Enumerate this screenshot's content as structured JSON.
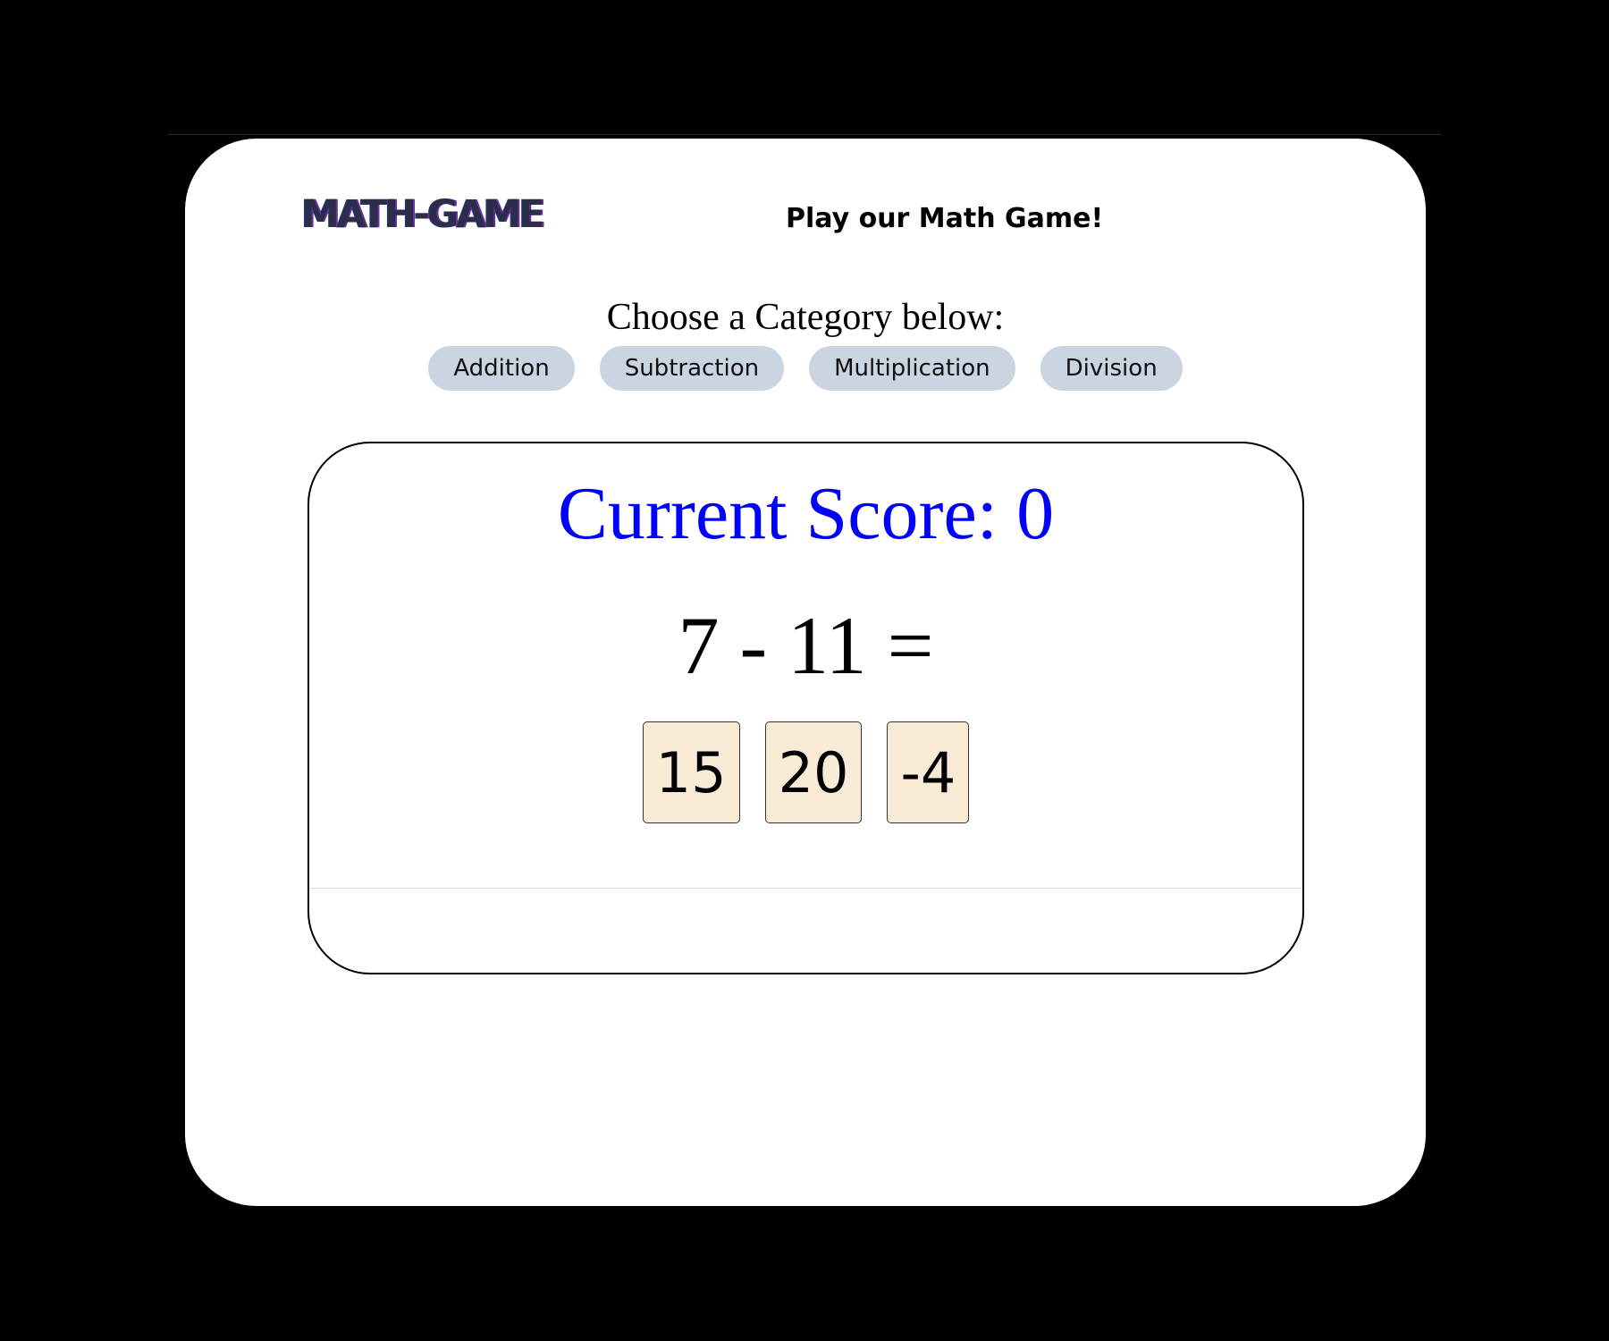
{
  "header": {
    "logo": "MATH-GAME",
    "tagline": "Play our Math Game!"
  },
  "categories": {
    "prompt": "Choose a Category below:",
    "buttons": [
      {
        "label": "Addition"
      },
      {
        "label": "Subtraction"
      },
      {
        "label": "Multiplication"
      },
      {
        "label": "Division"
      }
    ]
  },
  "game": {
    "score_text": "Current Score: 0",
    "question": "7 - 11 =",
    "answers": [
      {
        "value": "15"
      },
      {
        "value": "20"
      },
      {
        "value": "-4"
      }
    ]
  },
  "colors": {
    "score": "#0000ff",
    "category_button_bg": "#cbd5e1",
    "answer_tile_bg": "#faebd7",
    "page_bg": "#000000",
    "card_bg": "#ffffff"
  }
}
